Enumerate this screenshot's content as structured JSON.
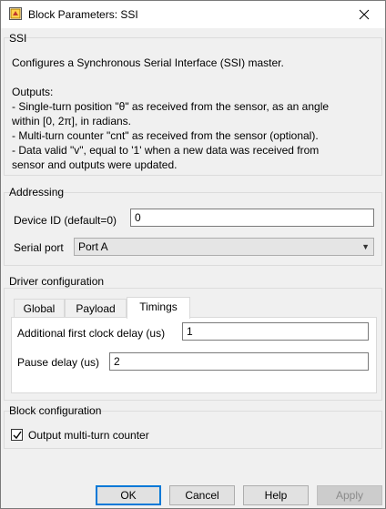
{
  "window": {
    "title": "Block Parameters: SSI"
  },
  "ssi_group": {
    "title": "SSI",
    "lines": [
      "Configures a Synchronous Serial Interface (SSI) master.",
      "",
      "Outputs:",
      "- Single-turn position \"θ\" as received from the sensor, as an angle",
      "within [0, 2π], in radians.",
      "- Multi-turn counter \"cnt\" as received from the sensor (optional).",
      "- Data valid \"v\", equal to '1' when a new data was received from",
      "sensor and outputs were updated."
    ]
  },
  "addressing": {
    "title": "Addressing",
    "device_id_label": "Device ID (default=0)",
    "device_id_value": "0",
    "serial_port_label": "Serial port",
    "serial_port_value": "Port A"
  },
  "driver": {
    "title": "Driver configuration",
    "tabs": [
      "Global",
      "Payload",
      "Timings"
    ],
    "active_tab": "Timings",
    "first_clock_delay_label": "Additional first clock delay (us)",
    "first_clock_delay_value": "1",
    "pause_delay_label": "Pause delay (us)",
    "pause_delay_value": "2"
  },
  "block_config": {
    "title": "Block configuration",
    "checkbox_label": "Output multi-turn counter",
    "checkbox_checked": true
  },
  "buttons": {
    "ok": "OK",
    "cancel": "Cancel",
    "help": "Help",
    "apply": "Apply"
  },
  "colors": {
    "default_button_border": "#0078d7",
    "window_bg": "#f0f0f0"
  }
}
